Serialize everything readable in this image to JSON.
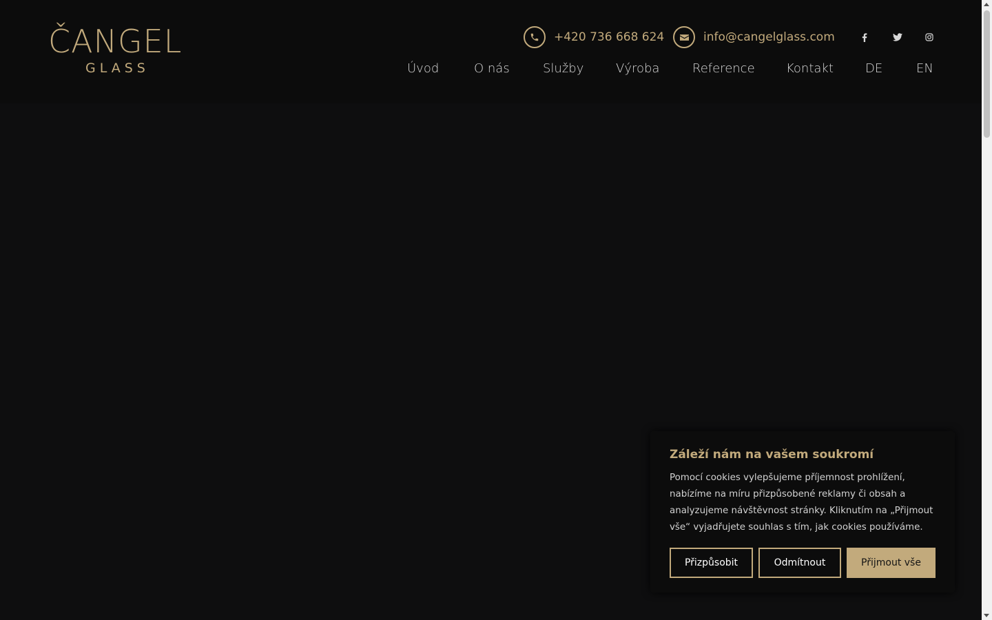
{
  "brand": {
    "logo_top": "ČANGEL",
    "logo_bottom": "GLASS",
    "accent_color": "#c2aa7c"
  },
  "contact": {
    "phone": "+420 736 668 624",
    "email": "info@cangelglass.com",
    "phone_icon": "phone-icon",
    "email_icon": "envelope-icon"
  },
  "social": [
    {
      "icon": "facebook-icon"
    },
    {
      "icon": "twitter-icon"
    },
    {
      "icon": "instagram-icon"
    }
  ],
  "nav": {
    "items": [
      {
        "label": "Úvod"
      },
      {
        "label": "O nás"
      },
      {
        "label": "Služby"
      },
      {
        "label": "Výroba"
      },
      {
        "label": "Reference"
      },
      {
        "label": "Kontakt"
      },
      {
        "label": "DE"
      },
      {
        "label": "EN"
      }
    ]
  },
  "cookie": {
    "title": "Záleží nám na vašem soukromí",
    "text": "Pomocí cookies vylepšujeme příjemnost prohlížení, nabízíme na míru přizpůsobené reklamy či obsah a analyzujeme návštěvnost stránky. Kliknutím na „Přijmout vše“ vyjadřujete souhlas s tím, jak cookies používáme.",
    "customize_label": "Přizpůsobit",
    "reject_label": "Odmítnout",
    "accept_label": "Přijmout vše"
  }
}
